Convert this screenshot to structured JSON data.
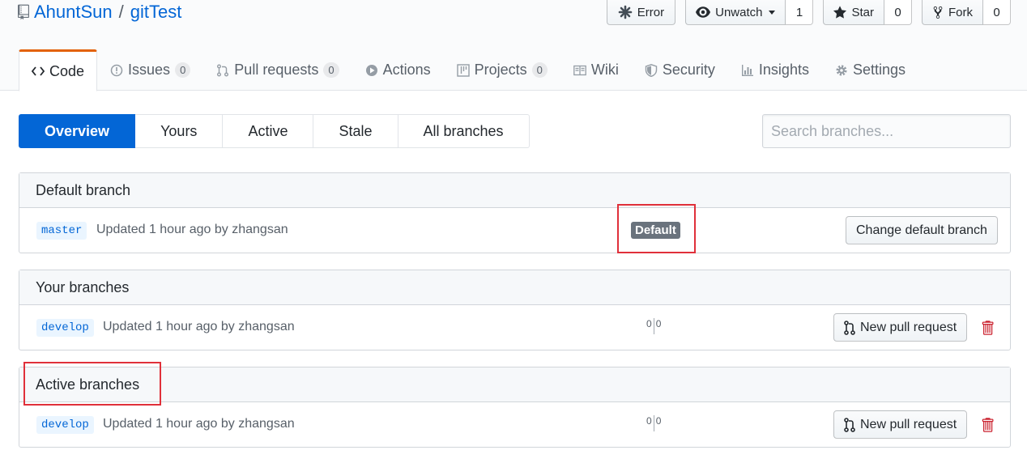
{
  "repo": {
    "owner": "AhuntSun",
    "separator": "/",
    "name": "gitTest"
  },
  "actions": {
    "error_label": "Error",
    "watch_label": "Unwatch",
    "watch_count": "1",
    "star_label": "Star",
    "star_count": "0",
    "fork_label": "Fork",
    "fork_count": "0"
  },
  "tabs": [
    {
      "label": "Code",
      "icon": "code-icon",
      "counter": ""
    },
    {
      "label": "Issues",
      "icon": "issue-icon",
      "counter": "0"
    },
    {
      "label": "Pull requests",
      "icon": "pull-request-icon",
      "counter": "0"
    },
    {
      "label": "Actions",
      "icon": "play-icon",
      "counter": ""
    },
    {
      "label": "Projects",
      "icon": "project-icon",
      "counter": "0"
    },
    {
      "label": "Wiki",
      "icon": "book-icon",
      "counter": ""
    },
    {
      "label": "Security",
      "icon": "shield-icon",
      "counter": ""
    },
    {
      "label": "Insights",
      "icon": "graph-icon",
      "counter": ""
    },
    {
      "label": "Settings",
      "icon": "gear-icon",
      "counter": ""
    }
  ],
  "subnav": [
    "Overview",
    "Yours",
    "Active",
    "Stale",
    "All branches"
  ],
  "search": {
    "placeholder": "Search branches..."
  },
  "sections": {
    "default": {
      "title": "Default branch",
      "branch": "master",
      "updated": "Updated 1 hour ago by zhangsan",
      "badge": "Default",
      "button": "Change default branch"
    },
    "yours": {
      "title": "Your branches",
      "branch": "develop",
      "updated": "Updated 1 hour ago by zhangsan",
      "behind": "0",
      "ahead": "0",
      "button": "New pull request"
    },
    "active": {
      "title": "Active branches",
      "branch": "develop",
      "updated": "Updated 1 hour ago by zhangsan",
      "behind": "0",
      "ahead": "0",
      "button": "New pull request"
    }
  },
  "colors": {
    "link": "#0366d6",
    "selected_tab_accent": "#e36209",
    "annotation_red": "#e0303a",
    "delete_red": "#cb2431"
  }
}
